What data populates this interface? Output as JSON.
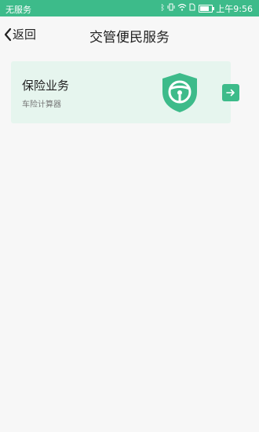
{
  "status_bar": {
    "carrier": "无服务",
    "time": "上午9:56",
    "battery_level": 0.75,
    "icons": [
      "bluetooth-icon",
      "vibrate-icon",
      "wifi-icon",
      "sim-icon",
      "battery-icon"
    ]
  },
  "nav": {
    "back_label": "返回",
    "title": "交管便民服务"
  },
  "card": {
    "title": "保险业务",
    "subtitle": "车险计算器",
    "icon": "steering-wheel-shield-icon",
    "action_icon": "arrow-right-icon"
  },
  "colors": {
    "accent": "#3dbb8a",
    "card_bg": "#e6f5ee",
    "page_bg": "#f7f7f7"
  }
}
